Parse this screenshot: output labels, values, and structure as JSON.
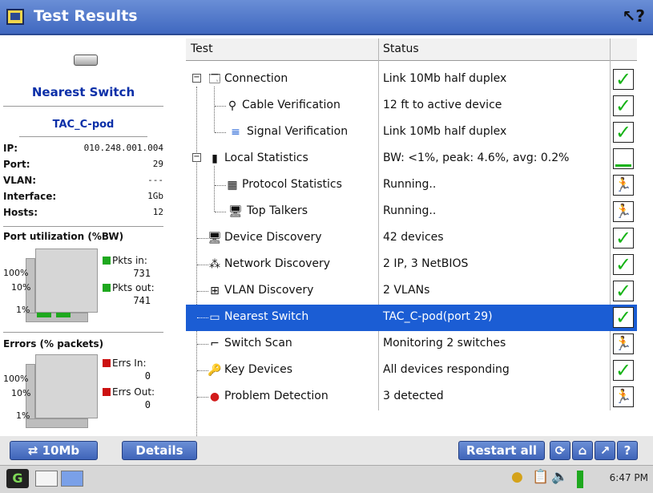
{
  "window": {
    "title": "Test Results",
    "help_glyph": "↖?"
  },
  "left": {
    "nearest_title": "Nearest Switch",
    "device_name": "TAC_C-pod",
    "info": [
      {
        "key": "IP:",
        "value": "010.248.001.004"
      },
      {
        "key": "Port:",
        "value": "29"
      },
      {
        "key": "VLAN:",
        "value": "---"
      },
      {
        "key": "Interface:",
        "value": "1Gb"
      },
      {
        "key": "Hosts:",
        "value": "12"
      }
    ],
    "port_util": {
      "title": "Port utilization (%BW)",
      "y_labels": [
        "100%",
        "10%",
        "1%"
      ],
      "pkts_in_label": "Pkts in:",
      "pkts_in_value": "731",
      "pkts_out_label": "Pkts out:",
      "pkts_out_value": "741",
      "in_color": "#1ea81e",
      "out_color": "#1ea81e"
    },
    "errors": {
      "title": "Errors (% packets)",
      "y_labels": [
        "100%",
        "10%",
        "1%"
      ],
      "errs_in_label": "Errs In:",
      "errs_in_value": "0",
      "errs_out_label": "Errs Out:",
      "errs_out_value": "0",
      "color": "#cc1111"
    }
  },
  "table": {
    "col_test": "Test",
    "col_status": "Status",
    "rows": [
      {
        "name": "Connection",
        "status": "Link 10Mb half duplex",
        "icon": "connection-icon",
        "result": "pass"
      },
      {
        "name": "Cable Verification",
        "status": "12 ft to active device",
        "icon": "cable-verification-icon",
        "result": "pass"
      },
      {
        "name": "Signal Verification",
        "status": "Link 10Mb half duplex",
        "icon": "signal-verification-icon",
        "result": "pass"
      },
      {
        "name": "Local Statistics",
        "status": "BW: <1%, peak: 4.6%, avg: 0.2%",
        "icon": "local-statistics-icon",
        "result": "blank"
      },
      {
        "name": "Protocol Statistics",
        "status": "Running..",
        "icon": "protocol-statistics-icon",
        "result": "running"
      },
      {
        "name": "Top Talkers",
        "status": "Running..",
        "icon": "top-talkers-icon",
        "result": "running"
      },
      {
        "name": "Device Discovery",
        "status": "42 devices",
        "icon": "device-discovery-icon",
        "result": "pass"
      },
      {
        "name": "Network Discovery",
        "status": "2 IP, 3 NetBIOS",
        "icon": "network-discovery-icon",
        "result": "pass"
      },
      {
        "name": "VLAN Discovery",
        "status": "2 VLANs",
        "icon": "vlan-discovery-icon",
        "result": "pass"
      },
      {
        "name": "Nearest Switch",
        "status": "TAC_C-pod(port 29)",
        "icon": "nearest-switch-icon",
        "result": "pass"
      },
      {
        "name": "Switch Scan",
        "status": "Monitoring 2 switches",
        "icon": "switch-scan-icon",
        "result": "running"
      },
      {
        "name": "Key Devices",
        "status": "All devices responding",
        "icon": "key-devices-icon",
        "result": "pass"
      },
      {
        "name": "Problem Detection",
        "status": "3 detected",
        "icon": "problem-detection-icon",
        "result": "running"
      }
    ]
  },
  "bottom": {
    "link_label": "10Mb",
    "details_label": "Details",
    "restart_label": "Restart all"
  },
  "taskbar": {
    "clock": "6:47 PM"
  }
}
